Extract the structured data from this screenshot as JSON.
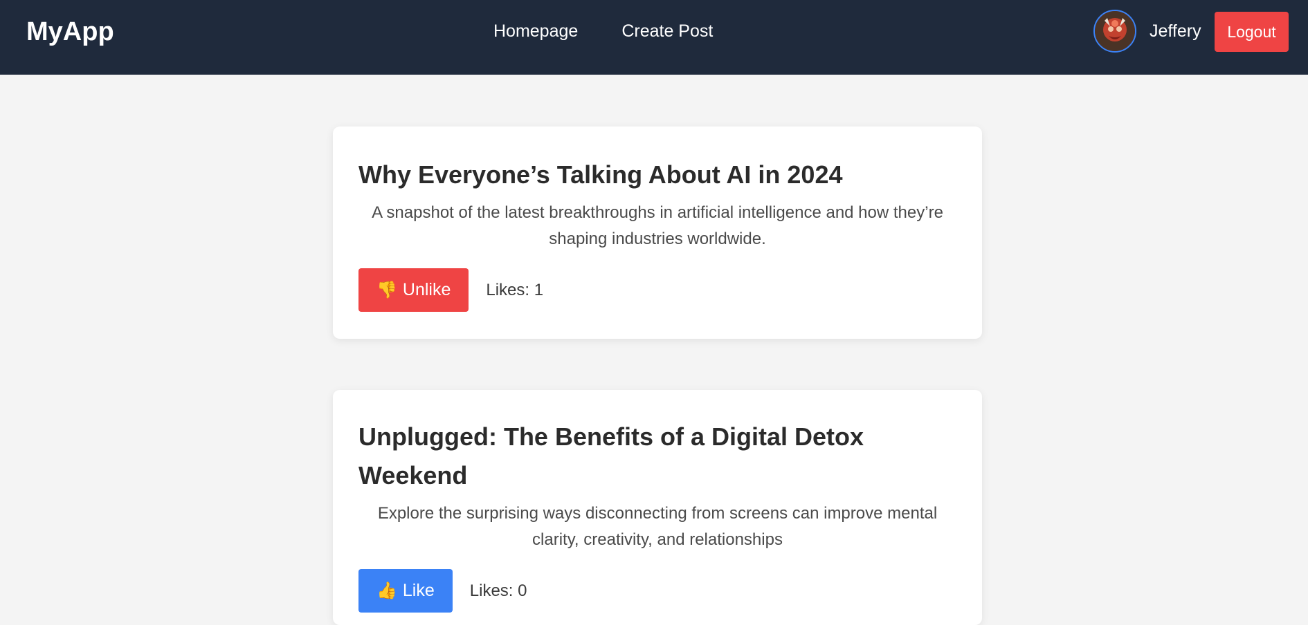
{
  "header": {
    "brand": "MyApp",
    "nav": [
      {
        "label": "Homepage"
      },
      {
        "label": "Create Post"
      }
    ],
    "user": {
      "name": "Jeffery",
      "avatar_icon": "avatar-image"
    },
    "logout_label": "Logout"
  },
  "posts": [
    {
      "title": "Why Everyone’s Talking About AI in 2024",
      "description": "A snapshot of the latest breakthroughs in artificial intelligence and how they’re shaping industries worldwide.",
      "button_icon": "👎",
      "button_label": "Unlike",
      "button_color": "#ef4444",
      "likes_text": "Likes: 1"
    },
    {
      "title": "Unplugged: The Benefits of a Digital Detox Weekend",
      "description": "Explore the surprising ways disconnecting from screens can improve mental clarity, creativity, and relationships",
      "button_icon": "👍",
      "button_label": "Like",
      "button_color": "#3b82f6",
      "likes_text": "Likes: 0"
    }
  ],
  "colors": {
    "navbar": "#1f2a3c",
    "page_bg": "#f4f4f4",
    "danger": "#ef4444",
    "primary": "#3b82f6"
  }
}
